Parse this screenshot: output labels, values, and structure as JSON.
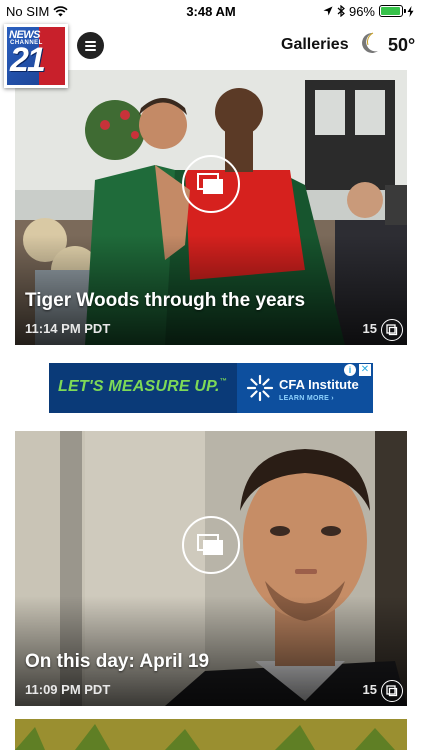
{
  "status_bar": {
    "carrier": "No SIM",
    "time": "3:48 AM",
    "battery_percent": "96%",
    "battery_level": 0.96,
    "battery_color": "#37c24a"
  },
  "header": {
    "logo": {
      "line1": "NEWS",
      "line2": "CHANNEL",
      "number": "21"
    },
    "menu_icon": "hamburger-icon",
    "galleries_label": "Galleries",
    "weather_icon": "moon-icon",
    "temperature": "50°"
  },
  "galleries": [
    {
      "title": "Tiger Woods through the years",
      "time": "11:14 PM PDT",
      "count": "15"
    },
    {
      "title": "On this day: April 19",
      "time": "11:09 PM PDT",
      "count": "15"
    }
  ],
  "ad": {
    "headline": "LET'S MEASURE UP.",
    "trademark": "™",
    "brand": "CFA Institute",
    "cta": "LEARN MORE ›",
    "info_glyph": "i",
    "close_glyph": "✕"
  },
  "colors": {
    "ad_background": "#0a3a78",
    "ad_headline": "#7ed957",
    "logo_blue": "#2a5fbf",
    "logo_red": "#c8202b"
  }
}
